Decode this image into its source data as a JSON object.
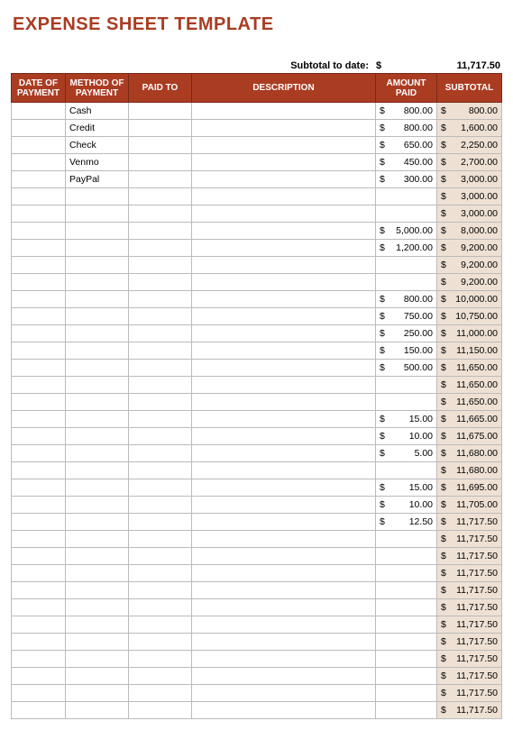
{
  "title": "EXPENSE SHEET TEMPLATE",
  "summary": {
    "label": "Subtotal to date:",
    "currency": "$",
    "value": "11,717.50"
  },
  "headers": {
    "date": "DATE OF PAYMENT",
    "method": "METHOD OF PAYMENT",
    "paid_to": "PAID TO",
    "description": "DESCRIPTION",
    "amount": "AMOUNT PAID",
    "subtotal": "SUBTOTAL"
  },
  "currency_symbol": "$",
  "rows": [
    {
      "date": "",
      "method": "Cash",
      "paid_to": "",
      "description": "",
      "amount": "800.00",
      "subtotal": "800.00"
    },
    {
      "date": "",
      "method": "Credit",
      "paid_to": "",
      "description": "",
      "amount": "800.00",
      "subtotal": "1,600.00"
    },
    {
      "date": "",
      "method": "Check",
      "paid_to": "",
      "description": "",
      "amount": "650.00",
      "subtotal": "2,250.00"
    },
    {
      "date": "",
      "method": "Venmo",
      "paid_to": "",
      "description": "",
      "amount": "450.00",
      "subtotal": "2,700.00"
    },
    {
      "date": "",
      "method": "PayPal",
      "paid_to": "",
      "description": "",
      "amount": "300.00",
      "subtotal": "3,000.00"
    },
    {
      "date": "",
      "method": "",
      "paid_to": "",
      "description": "",
      "amount": "",
      "subtotal": "3,000.00"
    },
    {
      "date": "",
      "method": "",
      "paid_to": "",
      "description": "",
      "amount": "",
      "subtotal": "3,000.00"
    },
    {
      "date": "",
      "method": "",
      "paid_to": "",
      "description": "",
      "amount": "5,000.00",
      "subtotal": "8,000.00"
    },
    {
      "date": "",
      "method": "",
      "paid_to": "",
      "description": "",
      "amount": "1,200.00",
      "subtotal": "9,200.00"
    },
    {
      "date": "",
      "method": "",
      "paid_to": "",
      "description": "",
      "amount": "",
      "subtotal": "9,200.00"
    },
    {
      "date": "",
      "method": "",
      "paid_to": "",
      "description": "",
      "amount": "",
      "subtotal": "9,200.00"
    },
    {
      "date": "",
      "method": "",
      "paid_to": "",
      "description": "",
      "amount": "800.00",
      "subtotal": "10,000.00"
    },
    {
      "date": "",
      "method": "",
      "paid_to": "",
      "description": "",
      "amount": "750.00",
      "subtotal": "10,750.00"
    },
    {
      "date": "",
      "method": "",
      "paid_to": "",
      "description": "",
      "amount": "250.00",
      "subtotal": "11,000.00"
    },
    {
      "date": "",
      "method": "",
      "paid_to": "",
      "description": "",
      "amount": "150.00",
      "subtotal": "11,150.00"
    },
    {
      "date": "",
      "method": "",
      "paid_to": "",
      "description": "",
      "amount": "500.00",
      "subtotal": "11,650.00"
    },
    {
      "date": "",
      "method": "",
      "paid_to": "",
      "description": "",
      "amount": "",
      "subtotal": "11,650.00"
    },
    {
      "date": "",
      "method": "",
      "paid_to": "",
      "description": "",
      "amount": "",
      "subtotal": "11,650.00"
    },
    {
      "date": "",
      "method": "",
      "paid_to": "",
      "description": "",
      "amount": "15.00",
      "subtotal": "11,665.00"
    },
    {
      "date": "",
      "method": "",
      "paid_to": "",
      "description": "",
      "amount": "10.00",
      "subtotal": "11,675.00"
    },
    {
      "date": "",
      "method": "",
      "paid_to": "",
      "description": "",
      "amount": "5.00",
      "subtotal": "11,680.00"
    },
    {
      "date": "",
      "method": "",
      "paid_to": "",
      "description": "",
      "amount": "",
      "subtotal": "11,680.00"
    },
    {
      "date": "",
      "method": "",
      "paid_to": "",
      "description": "",
      "amount": "15.00",
      "subtotal": "11,695.00"
    },
    {
      "date": "",
      "method": "",
      "paid_to": "",
      "description": "",
      "amount": "10.00",
      "subtotal": "11,705.00"
    },
    {
      "date": "",
      "method": "",
      "paid_to": "",
      "description": "",
      "amount": "12.50",
      "subtotal": "11,717.50"
    },
    {
      "date": "",
      "method": "",
      "paid_to": "",
      "description": "",
      "amount": "",
      "subtotal": "11,717.50"
    },
    {
      "date": "",
      "method": "",
      "paid_to": "",
      "description": "",
      "amount": "",
      "subtotal": "11,717.50"
    },
    {
      "date": "",
      "method": "",
      "paid_to": "",
      "description": "",
      "amount": "",
      "subtotal": "11,717.50"
    },
    {
      "date": "",
      "method": "",
      "paid_to": "",
      "description": "",
      "amount": "",
      "subtotal": "11,717.50"
    },
    {
      "date": "",
      "method": "",
      "paid_to": "",
      "description": "",
      "amount": "",
      "subtotal": "11,717.50"
    },
    {
      "date": "",
      "method": "",
      "paid_to": "",
      "description": "",
      "amount": "",
      "subtotal": "11,717.50"
    },
    {
      "date": "",
      "method": "",
      "paid_to": "",
      "description": "",
      "amount": "",
      "subtotal": "11,717.50"
    },
    {
      "date": "",
      "method": "",
      "paid_to": "",
      "description": "",
      "amount": "",
      "subtotal": "11,717.50"
    },
    {
      "date": "",
      "method": "",
      "paid_to": "",
      "description": "",
      "amount": "",
      "subtotal": "11,717.50"
    },
    {
      "date": "",
      "method": "",
      "paid_to": "",
      "description": "",
      "amount": "",
      "subtotal": "11,717.50"
    },
    {
      "date": "",
      "method": "",
      "paid_to": "",
      "description": "",
      "amount": "",
      "subtotal": "11,717.50"
    }
  ]
}
